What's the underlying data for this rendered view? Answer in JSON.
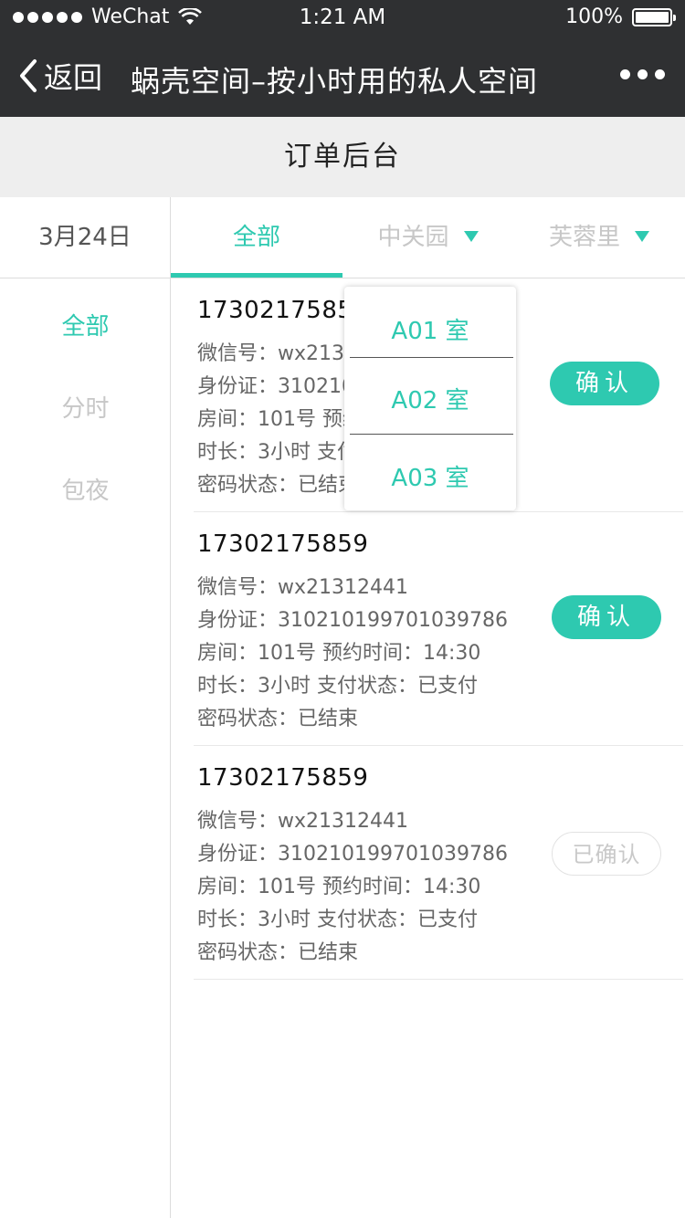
{
  "status_bar": {
    "carrier": "WeChat",
    "time": "1:21 AM",
    "battery": "100%",
    "battery_level": 1.0
  },
  "nav": {
    "back_label": "返回",
    "title": "蜗壳空间–按小时用的私人空间"
  },
  "page_title": "订单后台",
  "filters": {
    "date": "3月24日",
    "tabs": [
      {
        "label": "全部"
      },
      {
        "label": "中关园"
      },
      {
        "label": "芙蓉里"
      }
    ]
  },
  "sidebar": {
    "items": [
      {
        "label": "全部"
      },
      {
        "label": "分时"
      },
      {
        "label": "包夜"
      }
    ]
  },
  "dropdown": {
    "options": [
      {
        "label": "A01 室"
      },
      {
        "label": "A02 室"
      },
      {
        "label": "A03 室"
      }
    ]
  },
  "orders": [
    {
      "phone": "17302175859",
      "wechat": "微信号：wx21312441",
      "id_card": "身份证：310210199701039786",
      "room": "房间：101号  预约时间：14:30",
      "duration": "时长：3小时  支付状态：已支付",
      "password": "密码状态：已结束",
      "action": "确认"
    },
    {
      "phone": "17302175859",
      "wechat": "微信号：wx21312441",
      "id_card": "身份证：310210199701039786",
      "room": "房间：101号  预约时间：14:30",
      "duration": "时长：3小时  支付状态：已支付",
      "password": "密码状态：已结束",
      "action": "确认"
    },
    {
      "phone": "17302175859",
      "wechat": "微信号：wx21312441",
      "id_card": "身份证：310210199701039786",
      "room": "房间：101号  预约时间：14:30",
      "duration": "时长：3小时  支付状态：已支付",
      "password": "密码状态：已结束",
      "action": "已确认"
    }
  ],
  "colors": {
    "accent": "#2ec9b0",
    "nav_bg": "#2f3032",
    "header_bg": "#eeeeee"
  }
}
